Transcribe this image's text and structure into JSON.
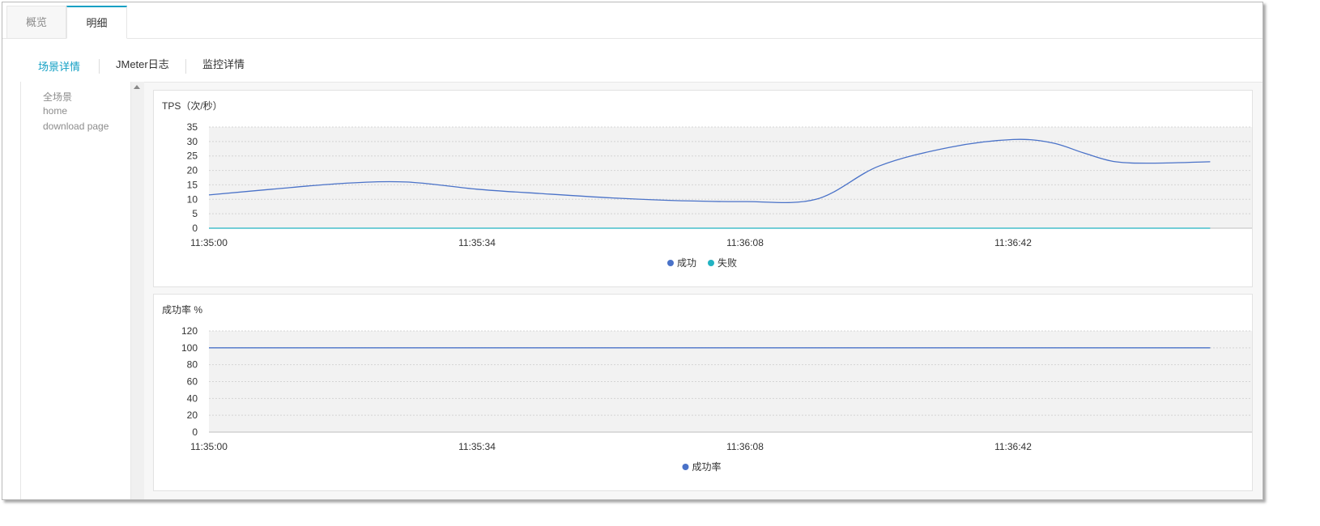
{
  "tabs": {
    "overview": "概览",
    "detail": "明细"
  },
  "subtabs": {
    "scene_detail": "场景详情",
    "jmeter_log": "JMeter日志",
    "monitor_detail": "监控详情"
  },
  "scenes": [
    "全场景",
    "home",
    "download page"
  ],
  "colors": {
    "accent": "#13a0c4",
    "success": "#4a72c8",
    "fail": "#22b3c2",
    "plot_bg": "#f2f2f2",
    "grid": "#d4d4d4"
  },
  "chart_data": [
    {
      "type": "line",
      "title": "TPS（次/秒）",
      "x_ticks": [
        "11:35:00",
        "11:35:34",
        "11:36:08",
        "11:36:42"
      ],
      "ylim": [
        0,
        35
      ],
      "y_ticks": [
        "35",
        "30",
        "25",
        "20",
        "15",
        "10",
        "5",
        "0"
      ],
      "grid": true,
      "legend_position": "bottom-center",
      "series": [
        {
          "name": "成功",
          "color": "#4a72c8",
          "points": [
            [
              "11:35:00",
              11.5
            ],
            [
              "11:35:08",
              13.5
            ],
            [
              "11:35:17",
              15.5
            ],
            [
              "11:35:25",
              16.0
            ],
            [
              "11:35:34",
              13.5
            ],
            [
              "11:35:42",
              12.0
            ],
            [
              "11:35:51",
              10.5
            ],
            [
              "11:36:00",
              9.5
            ],
            [
              "11:36:08",
              9.2
            ],
            [
              "11:36:17",
              10.0
            ],
            [
              "11:36:25",
              21.5
            ],
            [
              "11:36:34",
              28.0
            ],
            [
              "11:36:42",
              30.7
            ],
            [
              "11:36:47",
              29.5
            ],
            [
              "11:36:51",
              26.0
            ],
            [
              "11:36:55",
              23.0
            ],
            [
              "11:37:00",
              22.5
            ],
            [
              "11:37:07",
              23.0
            ]
          ]
        },
        {
          "name": "失败",
          "color": "#22b3c2",
          "points": [
            [
              "11:35:00",
              0
            ],
            [
              "11:37:07",
              0
            ]
          ]
        }
      ]
    },
    {
      "type": "line",
      "title": "成功率 %",
      "x_ticks": [
        "11:35:00",
        "11:35:34",
        "11:36:08",
        "11:36:42"
      ],
      "ylim": [
        0,
        120
      ],
      "y_ticks": [
        "120",
        "100",
        "80",
        "60",
        "40",
        "20",
        "0"
      ],
      "grid": true,
      "legend_position": "bottom-center",
      "series": [
        {
          "name": "成功率",
          "color": "#4a72c8",
          "points": [
            [
              "11:35:00",
              100
            ],
            [
              "11:37:07",
              100
            ]
          ]
        }
      ]
    }
  ]
}
